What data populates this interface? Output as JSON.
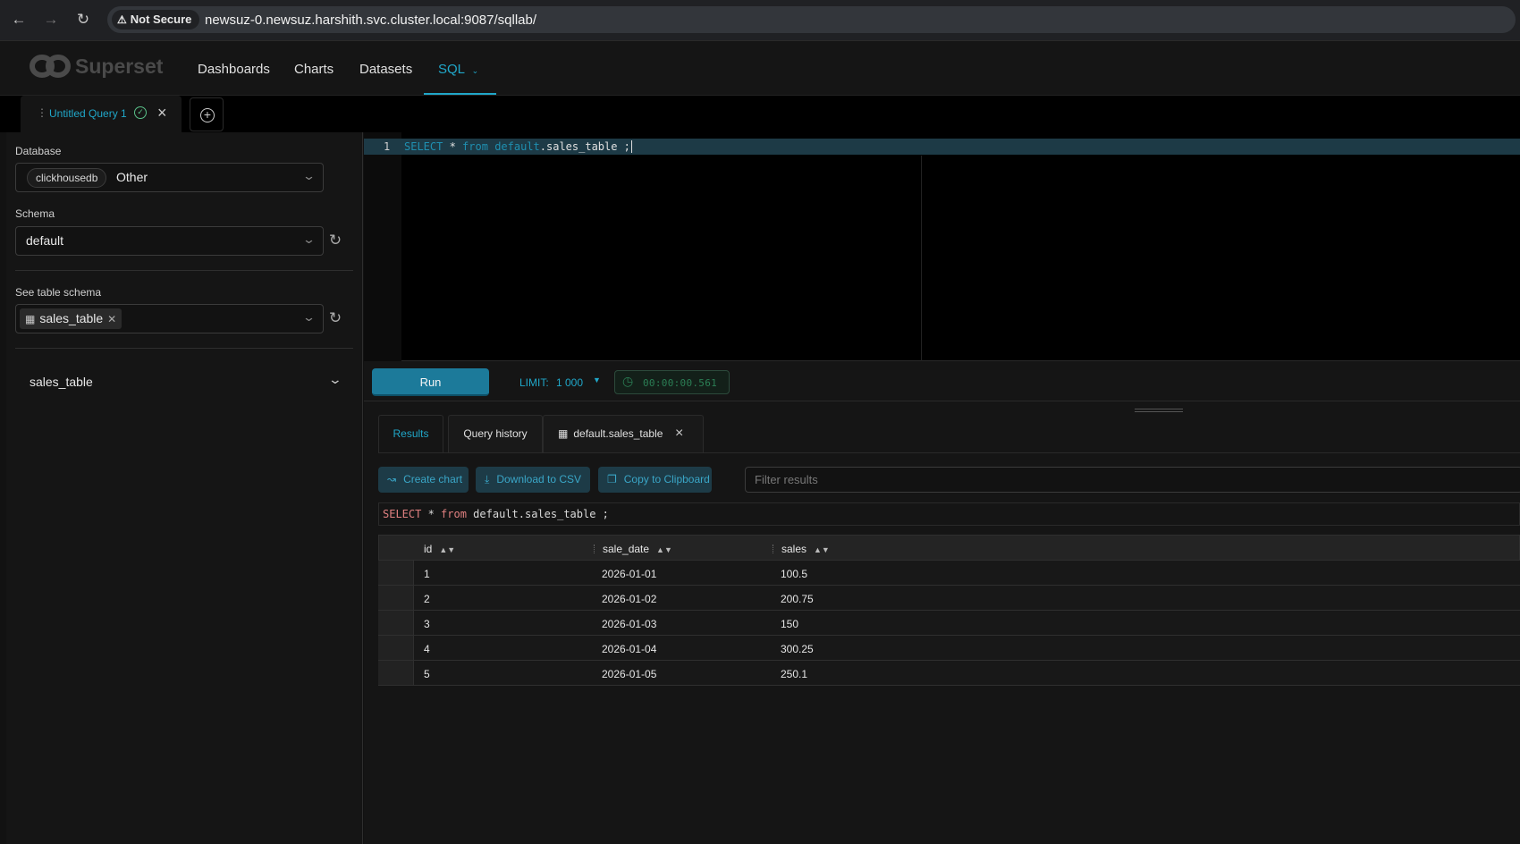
{
  "browser": {
    "security_label": "Not Secure",
    "url": "newsuz-0.newsuz.harshith.svc.cluster.local:9087/sqllab/"
  },
  "app": {
    "brand": "Superset",
    "menu": [
      "Dashboards",
      "Charts",
      "Datasets",
      "SQL"
    ],
    "active_menu": "SQL"
  },
  "query_tab": {
    "title": "Untitled Query 1"
  },
  "sidebar": {
    "database_label": "Database",
    "database_tag": "clickhousedb",
    "database_value": "Other",
    "schema_label": "Schema",
    "schema_value": "default",
    "table_schema_label": "See table schema",
    "selected_table": "sales_table",
    "table_section_title": "sales_table"
  },
  "editor": {
    "line_number": "1",
    "tokens": {
      "select": "SELECT",
      "star": " * ",
      "from": "from",
      "space": " ",
      "schema": "default",
      "table": ".sales_table ;"
    }
  },
  "runbar": {
    "run_label": "Run",
    "limit_label": "LIMIT:",
    "limit_value": "1 000",
    "elapsed": "00:00:00.561"
  },
  "results": {
    "tabs": [
      "Results",
      "Query history",
      "default.sales_table"
    ],
    "actions": {
      "create_chart": "Create chart",
      "download_csv": "Download to CSV",
      "copy_clipboard": "Copy to Clipboard"
    },
    "filter_placeholder": "Filter results",
    "sql_preview": {
      "select": "SELECT",
      "star": " * ",
      "from": "from",
      "rest": " default.sales_table ;"
    },
    "columns": [
      "id",
      "sale_date",
      "sales"
    ],
    "rows": [
      [
        "1",
        "2026-01-01",
        "100.5"
      ],
      [
        "2",
        "2026-01-02",
        "200.75"
      ],
      [
        "3",
        "2026-01-03",
        "150"
      ],
      [
        "4",
        "2026-01-04",
        "300.25"
      ],
      [
        "5",
        "2026-01-05",
        "250.1"
      ]
    ]
  },
  "colors": {
    "accent": "#20a7c9",
    "run_button": "#1c7a9a",
    "success": "#5ac189"
  }
}
